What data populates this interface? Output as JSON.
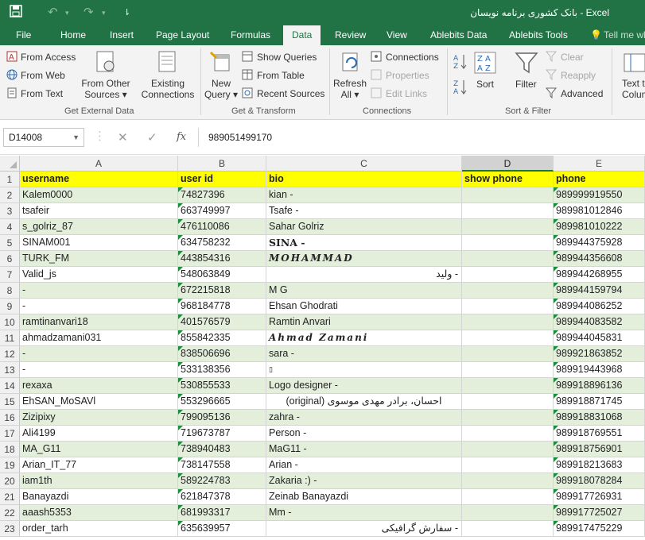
{
  "window": {
    "title": "بانک کشوری برنامه نویسان - Excel",
    "quick_access": {
      "save": "save-icon",
      "undo": "undo-icon",
      "redo": "redo-icon",
      "customize": "customize-icon"
    }
  },
  "tabs": [
    "File",
    "Home",
    "Insert",
    "Page Layout",
    "Formulas",
    "Data",
    "Review",
    "View",
    "Ablebits Data",
    "Ablebits Tools"
  ],
  "active_tab": "Data",
  "tell_me": "Tell me wh",
  "ribbon": {
    "get_external_data": {
      "label": "Get External Data",
      "from_access": "From Access",
      "from_web": "From Web",
      "from_text": "From Text",
      "from_other_sources": [
        "From Other",
        "Sources"
      ],
      "existing_connections": [
        "Existing",
        "Connections"
      ]
    },
    "get_transform": {
      "label": "Get & Transform",
      "new_query": [
        "New",
        "Query"
      ],
      "show_queries": "Show Queries",
      "from_table": "From Table",
      "recent_sources": "Recent Sources"
    },
    "connections": {
      "label": "Connections",
      "refresh_all": [
        "Refresh",
        "All"
      ],
      "connections": "Connections",
      "properties": "Properties",
      "edit_links": "Edit Links"
    },
    "sort_filter": {
      "label": "Sort & Filter",
      "sort": "Sort",
      "filter": "Filter",
      "clear": "Clear",
      "reapply": "Reapply",
      "advanced": "Advanced"
    },
    "data_tools": {
      "text_to_columns": [
        "Text t",
        "Colum"
      ]
    }
  },
  "formula_bar": {
    "name_box": "D14008",
    "cancel": "✕",
    "enter": "✓",
    "fx": "fx",
    "formula": "989051499170"
  },
  "columns": [
    "A",
    "B",
    "C",
    "D",
    "E"
  ],
  "selected_column": "D",
  "header_row": {
    "num": "1",
    "cells": [
      "username",
      "user id",
      "bio",
      "show phone",
      "phone"
    ]
  },
  "rows": [
    {
      "num": "2",
      "cells": [
        "Kalem0000",
        "74827396",
        "kian -",
        "",
        "989999919550"
      ]
    },
    {
      "num": "3",
      "cells": [
        "tsafeir",
        "663749997",
        "Tsafe -",
        "",
        "989981012846"
      ]
    },
    {
      "num": "4",
      "cells": [
        "s_golriz_87",
        "476110086",
        "Sahar Golriz",
        "",
        "989981010222"
      ]
    },
    {
      "num": "5",
      "cells": [
        "SINAM001",
        "634758232",
        "SINA -",
        "",
        "989944375928"
      ]
    },
    {
      "num": "6",
      "cells": [
        "TURK_FM",
        "443854316",
        "MOHAMMAD",
        "",
        "989944356608"
      ]
    },
    {
      "num": "7",
      "cells": [
        "Valid_js",
        "548063849",
        "ولید -",
        "",
        "989944268955"
      ]
    },
    {
      "num": "8",
      "cells": [
        "-",
        "672215818",
        "M G",
        "",
        "989944159794"
      ]
    },
    {
      "num": "9",
      "cells": [
        "-",
        "968184778",
        "Ehsan Ghodrati",
        "",
        "989944086252"
      ]
    },
    {
      "num": "10",
      "cells": [
        "ramtinanvari18",
        "401576579",
        "Ramtin Anvari",
        "",
        "989944083582"
      ]
    },
    {
      "num": "11",
      "cells": [
        "ahmadzamani031",
        "855842335",
        "Ahmad Zamani",
        "",
        "989944045831"
      ]
    },
    {
      "num": "12",
      "cells": [
        "-",
        "838506696",
        "sara -",
        "",
        "989921863852"
      ]
    },
    {
      "num": "13",
      "cells": [
        "-",
        "533138356",
        "▯",
        "",
        "989919443968"
      ]
    },
    {
      "num": "14",
      "cells": [
        "rexaxa",
        "530855533",
        "Logo designer -",
        "",
        "989918896136"
      ]
    },
    {
      "num": "15",
      "cells": [
        "EhSAN_MoSAVl",
        "553296665",
        "احسان، برادر مهدی موسوی (original)",
        "",
        "989918871745"
      ]
    },
    {
      "num": "16",
      "cells": [
        "Zizipixy",
        "799095136",
        "zahra -",
        "",
        "989918831068"
      ]
    },
    {
      "num": "17",
      "cells": [
        "Ali4199",
        "719673787",
        "Person -",
        "",
        "989918769551"
      ]
    },
    {
      "num": "18",
      "cells": [
        "MA_G11",
        "738940483",
        "MaG11 -",
        "",
        "989918756901"
      ]
    },
    {
      "num": "19",
      "cells": [
        "Arian_IT_77",
        "738147558",
        "Arian -",
        "",
        "989918213683"
      ]
    },
    {
      "num": "20",
      "cells": [
        "iam1th",
        "589224783",
        "Zakaria :) -",
        "",
        "989918078284"
      ]
    },
    {
      "num": "21",
      "cells": [
        "Banayazdi",
        "621847378",
        "Zeinab Banayazdi",
        "",
        "989917726931"
      ]
    },
    {
      "num": "22",
      "cells": [
        "aaash5353",
        "681993317",
        "Mm -",
        "",
        "989917725027"
      ]
    },
    {
      "num": "23",
      "cells": [
        "order_tarh",
        "635639957",
        "سفارش گرافیکی -",
        "",
        "989917475229"
      ]
    }
  ],
  "colors": {
    "excel_green": "#217346",
    "header_fill": "#ffff00",
    "band_fill": "#e3efda"
  }
}
